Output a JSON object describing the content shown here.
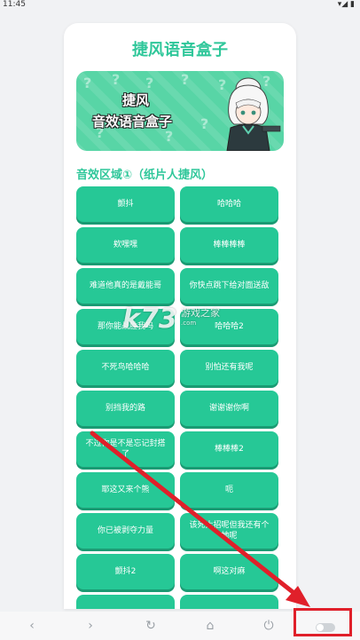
{
  "status_bar": {
    "time": "11:45",
    "icons": "▾◢ ▮"
  },
  "app": {
    "title": "捷风语音盒子"
  },
  "banner": {
    "line1": "捷风",
    "line2": "音效语音盒子"
  },
  "section": {
    "title": "音效区域①（纸片人捷风）"
  },
  "sounds": [
    "颤抖",
    "哈哈哈",
    "欸嘿嘿",
    "棒棒棒棒",
    "难道他真的是戴能哥",
    "你快点跳下给对面送敌",
    "那你能战胜我吗",
    "哈哈哈2",
    "不死鸟哈哈哈",
    "别怕还有我呢",
    "别挡我的路",
    "谢谢谢你啊",
    "不过你是不是忘记封搭了",
    "棒棒棒2",
    "耶这又来个熊",
    "呃",
    "你已被剥夺力量",
    "该死大招呢但我还有个她呢",
    "颤抖2",
    "啊这对麻",
    "",
    ""
  ],
  "watermark": {
    "logo": "k73",
    "text": "游戏之家",
    "url": ".com"
  },
  "nav": {
    "back": "‹",
    "forward": "›",
    "refresh": "↻",
    "home": "⌂",
    "power": "⏻"
  },
  "icons": {
    "back": "chevron-left-icon",
    "forward": "chevron-right-icon",
    "refresh": "refresh-icon",
    "home": "home-icon",
    "power": "power-icon",
    "toggle": "toggle-switch-icon"
  },
  "colors": {
    "accent": "#2fc79a",
    "button": "#26c896",
    "highlight": "#e0202a"
  }
}
